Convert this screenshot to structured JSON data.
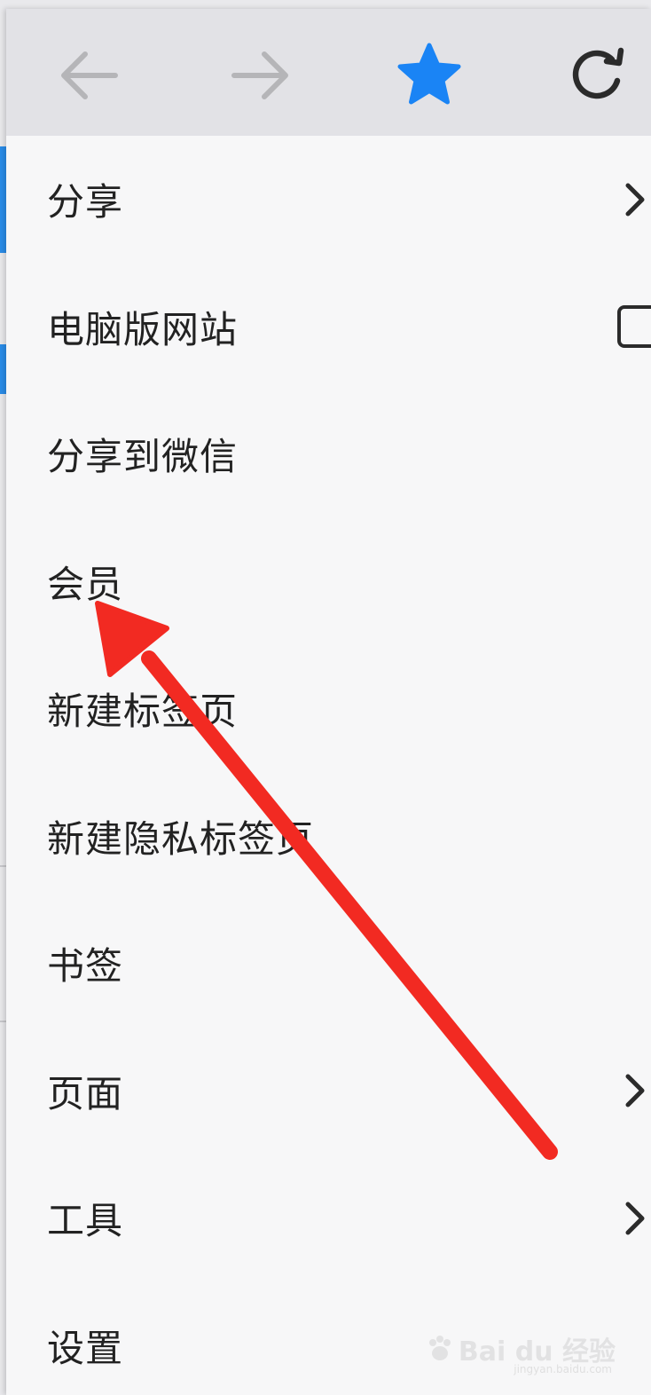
{
  "toolbar": {
    "back_icon": "arrow-left-icon",
    "forward_icon": "arrow-right-icon",
    "bookmark_icon": "star-icon",
    "reload_icon": "reload-icon",
    "accent_color": "#1a84f5",
    "disabled_color": "#b5b5b8"
  },
  "menu": {
    "items": [
      {
        "label": "分享",
        "trailing": "chevron"
      },
      {
        "label": "电脑版网站",
        "trailing": "checkbox"
      },
      {
        "label": "分享到微信",
        "trailing": "none"
      },
      {
        "label": "会员",
        "trailing": "none"
      },
      {
        "label": "新建标签页",
        "trailing": "none"
      },
      {
        "label": "新建隐私标签页",
        "trailing": "none"
      },
      {
        "label": "书签",
        "trailing": "none"
      },
      {
        "label": "页面",
        "trailing": "chevron"
      },
      {
        "label": "工具",
        "trailing": "chevron"
      },
      {
        "label": "设置",
        "trailing": "none"
      }
    ]
  },
  "annotation": {
    "color": "#f22a22",
    "points_to": "会员"
  },
  "watermark": {
    "text": "Bai du 经验",
    "sub": "jingyan.baidu.com"
  }
}
